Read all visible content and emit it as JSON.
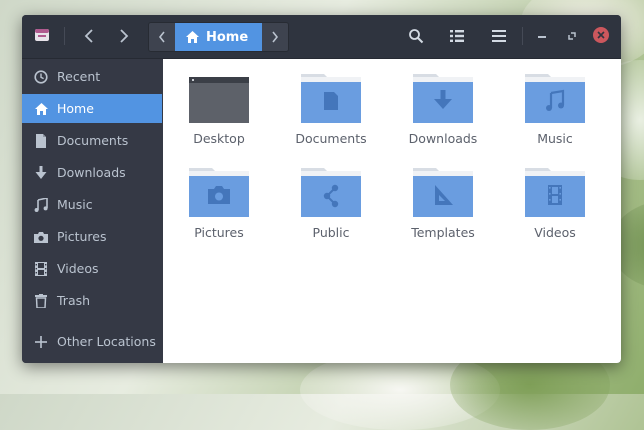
{
  "headerbar": {
    "path": {
      "current": "Home"
    }
  },
  "sidebar": {
    "items": [
      {
        "label": "Recent",
        "icon": "clock-icon",
        "active": false
      },
      {
        "label": "Home",
        "icon": "home-icon",
        "active": true
      },
      {
        "label": "Documents",
        "icon": "document-icon",
        "active": false
      },
      {
        "label": "Downloads",
        "icon": "download-icon",
        "active": false
      },
      {
        "label": "Music",
        "icon": "music-note-icon",
        "active": false
      },
      {
        "label": "Pictures",
        "icon": "camera-icon",
        "active": false
      },
      {
        "label": "Videos",
        "icon": "film-icon",
        "active": false
      },
      {
        "label": "Trash",
        "icon": "trash-icon",
        "active": false
      },
      {
        "label": "Other Locations",
        "icon": "plus-icon",
        "active": false
      }
    ]
  },
  "files": [
    {
      "label": "Desktop",
      "icon": "desktop-folder-icon"
    },
    {
      "label": "Documents",
      "icon": "documents-folder-icon"
    },
    {
      "label": "Downloads",
      "icon": "downloads-folder-icon"
    },
    {
      "label": "Music",
      "icon": "music-folder-icon"
    },
    {
      "label": "Pictures",
      "icon": "pictures-folder-icon"
    },
    {
      "label": "Public",
      "icon": "public-folder-icon"
    },
    {
      "label": "Templates",
      "icon": "templates-folder-icon"
    },
    {
      "label": "Videos",
      "icon": "videos-folder-icon"
    }
  ],
  "colors": {
    "accent": "#5294e2",
    "headerbar": "#2f343f",
    "sidebar": "#353945",
    "folder": "#6a9de0",
    "close": "#cc575d"
  }
}
